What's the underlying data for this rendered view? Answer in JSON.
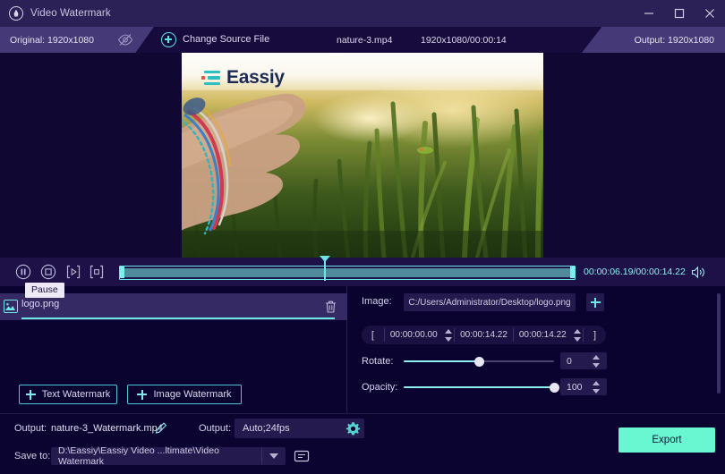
{
  "window": {
    "title": "Video Watermark",
    "app_icon": "water-drop-icon",
    "minimize": "minimize-icon",
    "maximize": "maximize-icon",
    "close": "close-icon"
  },
  "toolbar": {
    "original_tab": "Original: 1920x1080",
    "preview_toggle_icon": "eye-slash-icon",
    "change_source_label": "Change Source File",
    "add_icon": "plus-circle-icon",
    "file_name": "nature-3.mp4",
    "file_meta": "1920x1080/00:00:14",
    "output_tab": "Output: 1920x1080"
  },
  "preview": {
    "watermark_logo_text": "Eassiy",
    "logo_accent_color": "#2bbfc4",
    "logo_dot_color": "#e8503a",
    "logo_text_color": "#1b2a55"
  },
  "player": {
    "pause_icon": "pause-circle-icon",
    "stop_icon": "stop-circle-icon",
    "frame_prev_icon": "play-bracket-icon",
    "snapshot_icon": "snapshot-bracket-icon",
    "tooltip": "Pause",
    "time_display": "00:00:06.19/00:00:14.22",
    "volume_icon": "volume-icon",
    "playhead_percent": 45
  },
  "watermark_list": {
    "items": [
      {
        "icon": "image-thumb-icon",
        "name": "logo.png",
        "delete_icon": "trash-icon"
      }
    ]
  },
  "settings": {
    "image_label": "Image:",
    "image_path": "C:/Users/Administrator/Desktop/logo.png",
    "add_image_icon": "plus-icon",
    "range": {
      "open_bracket": "[",
      "start": "00:00:00.00",
      "middle": "00:00:14.22",
      "end": "00:00:14.22",
      "close_bracket": "]"
    },
    "rotate_label": "Rotate:",
    "rotate_value": "0",
    "rotate_percent": 50,
    "opacity_label": "Opacity:",
    "opacity_value": "100",
    "opacity_percent": 100
  },
  "add_buttons": {
    "text_watermark": "Text Watermark",
    "image_watermark": "Image Watermark"
  },
  "bottom": {
    "output_label_1": "Output:",
    "output_name": "nature-3_Watermark.mp4",
    "edit_icon": "pencil-icon",
    "output_label_2": "Output:",
    "format_value": "Auto;24fps",
    "settings_icon": "gear-icon",
    "save_to_label": "Save to:",
    "save_path": "D:\\Eassiy\\Eassiy Video ...ltimate\\Video Watermark",
    "dropdown_icon": "caret-down-icon",
    "folder_icon": "folder-icon",
    "export_label": "Export",
    "export_color": "#69f7d2"
  }
}
